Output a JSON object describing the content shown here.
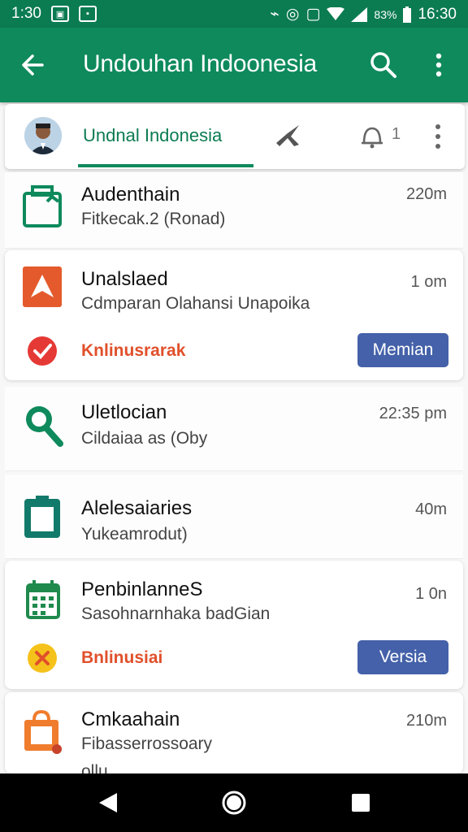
{
  "status_bar": {
    "time": "1:30",
    "time_right": "16:30",
    "battery": "83%"
  },
  "app_bar": {
    "title": "Undouhan Indoonesia"
  },
  "tab_card": {
    "tab_label": "Undnal Indonesia",
    "badge_count": "1"
  },
  "items": [
    {
      "title": "Audenthain",
      "sub": "Fitkecak.2 (Ronad)",
      "time": "220m"
    },
    {
      "title": "Unalslaed",
      "sub": "Cdmparan Olahansi Unapoika",
      "time": "1 om",
      "status": "Knlinusrarak",
      "action": "Memian"
    },
    {
      "title": "Uletlocian",
      "sub": "Cildaiaa as (Oby",
      "time": "22:35 pm"
    },
    {
      "title": "Alelesaiaries",
      "sub": "Yukeamrodut)",
      "time": "40m"
    },
    {
      "title": "PenbinlanneS",
      "sub": "Sasohnarnhaka badGian",
      "time": "1 0n",
      "status": "Bnlinusiai",
      "action": "Versia"
    },
    {
      "title": "Cmkaahain",
      "sub": "Fibasserrossoary",
      "extra": "ollu",
      "time": "210m"
    }
  ],
  "colors": {
    "primary": "#0e8a5c",
    "status_bar": "#0b7b52",
    "button": "#4461a9",
    "alert_text": "#e0502b"
  }
}
